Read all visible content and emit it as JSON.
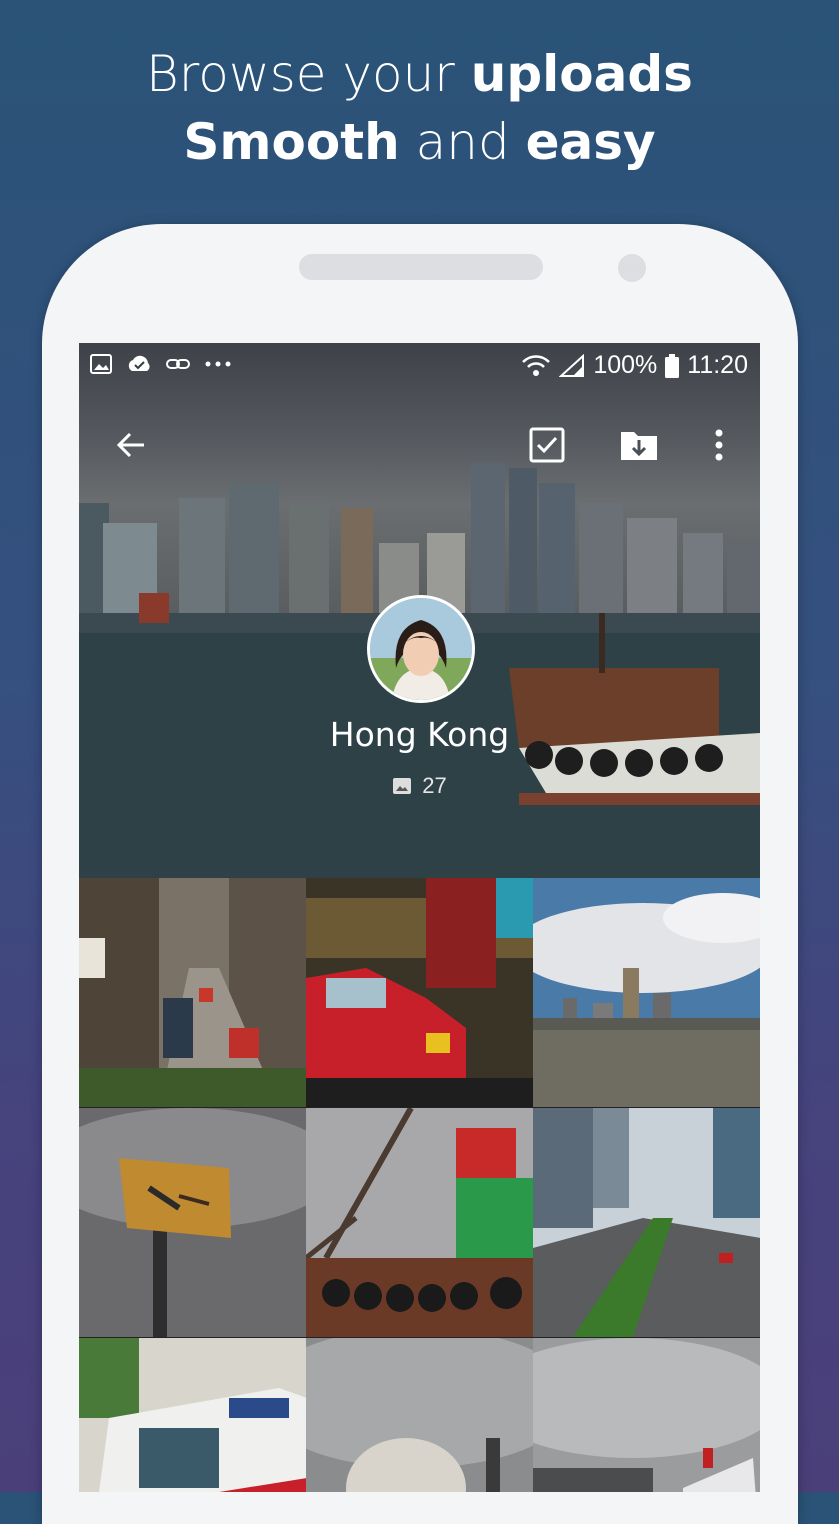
{
  "promo": {
    "line1_prefix": "Browse your ",
    "line1_bold": "uploads",
    "line2_bold_start": "Smooth",
    "line2_middle": " and ",
    "line2_bold_end": "easy"
  },
  "status_bar": {
    "notification_icons": [
      "image-icon",
      "cloud-check-icon",
      "link-icon",
      "more-dots-icon"
    ],
    "battery": "100%",
    "time": "11:20"
  },
  "toolbar": {
    "icons": [
      "back-arrow-icon",
      "select-checkbox-icon",
      "download-folder-icon",
      "overflow-menu-icon"
    ]
  },
  "album": {
    "title": "Hong Kong",
    "count": "27"
  },
  "photos": [
    {
      "name": "street-photo"
    },
    {
      "name": "red-taxi-photo"
    },
    {
      "name": "harbour-skyline-photo"
    },
    {
      "name": "tsim-sha-tsui-sign-photo"
    },
    {
      "name": "crane-boat-photo"
    },
    {
      "name": "highway-photo"
    },
    {
      "name": "ice-cream-truck-photo"
    },
    {
      "name": "dome-photo"
    },
    {
      "name": "cruise-ship-photo"
    }
  ],
  "colors": {
    "background_top": "#2a5377",
    "background_bottom": "#4b3f7a",
    "phone_body": "#f4f5f7"
  }
}
